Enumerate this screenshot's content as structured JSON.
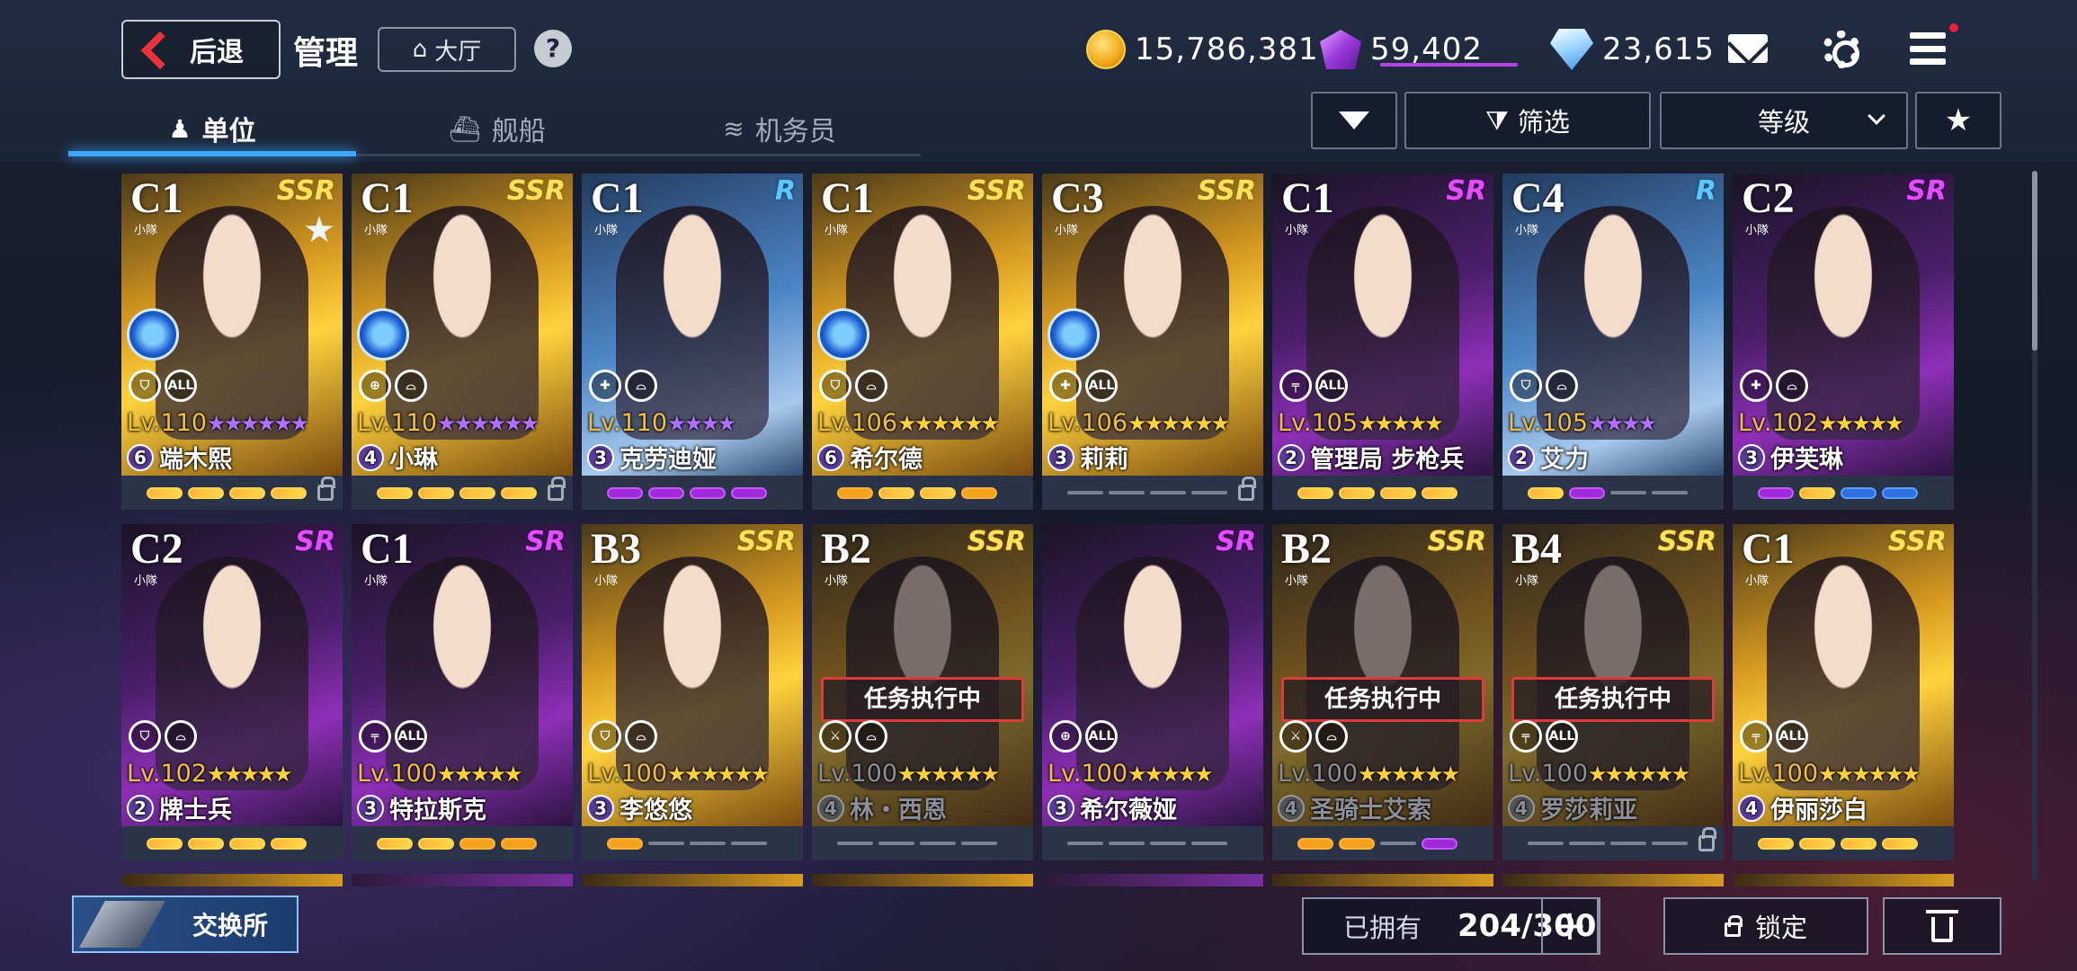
{
  "header": {
    "back_label": "后退",
    "title": "管理",
    "hall_label": "大厅",
    "help_label": "?"
  },
  "currency": {
    "gold": "15,786,381",
    "gems": "59,402",
    "diamonds": "23,615"
  },
  "tabs": [
    {
      "label": "单位",
      "icon": "person-icon",
      "active": true
    },
    {
      "label": "舰船",
      "icon": "ship-icon",
      "active": false
    },
    {
      "label": "机务员",
      "icon": "wings-icon",
      "active": false
    }
  ],
  "filters": {
    "filter_label": "筛选",
    "sort_label": "等级"
  },
  "units": [
    {
      "tier": "C1",
      "squad": "小隊",
      "rarity": "SSR",
      "level": "Lv.110",
      "stars": "★★★★★★",
      "star_color": "p",
      "count": "6",
      "name": "端木熙",
      "progress": [
        "y",
        "y",
        "y",
        "y"
      ],
      "locked": true,
      "favorite": true,
      "badge": true,
      "roles": [
        "shield",
        "ALL"
      ],
      "mission": ""
    },
    {
      "tier": "C1",
      "squad": "小隊",
      "rarity": "SSR",
      "level": "Lv.110",
      "stars": "★★★★★★",
      "star_color": "p",
      "count": "4",
      "name": "小琳",
      "progress": [
        "y",
        "y",
        "y",
        "y"
      ],
      "locked": true,
      "favorite": false,
      "badge": true,
      "roles": [
        "target",
        "sat"
      ],
      "mission": ""
    },
    {
      "tier": "C1",
      "squad": "小隊",
      "rarity": "R",
      "level": "Lv.110",
      "stars": "★★★★",
      "star_color": "p",
      "count": "3",
      "name": "克劳迪娅",
      "progress": [
        "p",
        "p",
        "p",
        "p"
      ],
      "locked": false,
      "favorite": false,
      "badge": false,
      "roles": [
        "support",
        "sat"
      ],
      "mission": ""
    },
    {
      "tier": "C1",
      "squad": "小隊",
      "rarity": "SSR",
      "level": "Lv.106",
      "stars": "★★★★★★",
      "star_color": "y",
      "count": "6",
      "name": "希尔德",
      "progress": [
        "o",
        "y",
        "y",
        "o"
      ],
      "locked": false,
      "favorite": false,
      "badge": true,
      "roles": [
        "shield",
        "sat"
      ],
      "mission": ""
    },
    {
      "tier": "C3",
      "squad": "小隊",
      "rarity": "SSR",
      "level": "Lv.106",
      "stars": "★★★★★★",
      "star_color": "y",
      "count": "3",
      "name": "莉莉",
      "progress": [
        "e",
        "e",
        "e",
        "e"
      ],
      "locked": true,
      "favorite": false,
      "badge": true,
      "roles": [
        "support",
        "ALL"
      ],
      "mission": ""
    },
    {
      "tier": "C1",
      "squad": "小隊",
      "rarity": "SR",
      "level": "Lv.105",
      "stars": "★★★★★",
      "star_color": "y",
      "count": "2",
      "name": "管理局 步枪兵",
      "progress": [
        "y",
        "y",
        "y",
        "y"
      ],
      "locked": false,
      "favorite": false,
      "badge": false,
      "roles": [
        "rifle",
        "ALL"
      ],
      "mission": ""
    },
    {
      "tier": "C4",
      "squad": "小隊",
      "rarity": "R",
      "level": "Lv.105",
      "stars": "★★★★",
      "star_color": "p",
      "count": "2",
      "name": "艾力",
      "progress": [
        "y",
        "p",
        "e",
        "e"
      ],
      "locked": false,
      "favorite": false,
      "badge": false,
      "roles": [
        "shield",
        "sat"
      ],
      "mission": ""
    },
    {
      "tier": "C2",
      "squad": "小隊",
      "rarity": "SR",
      "level": "Lv.102",
      "stars": "★★★★★",
      "star_color": "y",
      "count": "3",
      "name": "伊芙琳",
      "progress": [
        "p",
        "y",
        "b",
        "b"
      ],
      "locked": false,
      "favorite": false,
      "badge": false,
      "roles": [
        "support",
        "sat"
      ],
      "mission": ""
    },
    {
      "tier": "C2",
      "squad": "小隊",
      "rarity": "SR",
      "level": "Lv.102",
      "stars": "★★★★★",
      "star_color": "y",
      "count": "2",
      "name": "牌士兵",
      "progress": [
        "y",
        "y",
        "y",
        "y"
      ],
      "locked": false,
      "favorite": false,
      "badge": false,
      "roles": [
        "shield",
        "sat"
      ],
      "mission": ""
    },
    {
      "tier": "C1",
      "squad": "小隊",
      "rarity": "SR",
      "level": "Lv.100",
      "stars": "★★★★★",
      "star_color": "y",
      "count": "3",
      "name": "特拉斯克",
      "progress": [
        "y",
        "y",
        "o",
        "o"
      ],
      "locked": false,
      "favorite": false,
      "badge": false,
      "roles": [
        "rifle",
        "ALL"
      ],
      "mission": ""
    },
    {
      "tier": "B3",
      "squad": "小隊",
      "rarity": "SSR",
      "level": "Lv.100",
      "stars": "★★★★★★",
      "star_color": "y",
      "count": "3",
      "name": "李悠悠",
      "progress": [
        "o",
        "e",
        "e",
        "e"
      ],
      "locked": false,
      "favorite": false,
      "badge": false,
      "roles": [
        "shield",
        "sat"
      ],
      "mission": ""
    },
    {
      "tier": "B2",
      "squad": "小隊",
      "rarity": "SSR",
      "level": "Lv.100",
      "stars": "★★★★★★",
      "star_color": "y",
      "count": "4",
      "name": "林・西恩",
      "progress": [
        "e",
        "e",
        "e",
        "e"
      ],
      "locked": false,
      "favorite": false,
      "badge": false,
      "roles": [
        "sword",
        "sat"
      ],
      "mission": "任务执行中"
    },
    {
      "tier": "",
      "squad": "",
      "rarity": "SR",
      "level": "Lv.100",
      "stars": "★★★★★",
      "star_color": "y",
      "count": "3",
      "name": "希尔薇娅",
      "progress": [
        "e",
        "e",
        "e",
        "e"
      ],
      "locked": false,
      "favorite": false,
      "badge": false,
      "roles": [
        "target",
        "ALL"
      ],
      "mission": ""
    },
    {
      "tier": "B2",
      "squad": "小隊",
      "rarity": "SSR",
      "level": "Lv.100",
      "stars": "★★★★★★",
      "star_color": "y",
      "count": "4",
      "name": "圣骑士艾索",
      "progress": [
        "o",
        "o",
        "e",
        "p"
      ],
      "locked": false,
      "favorite": false,
      "badge": false,
      "roles": [
        "sword",
        "sat"
      ],
      "mission": "任务执行中"
    },
    {
      "tier": "B4",
      "squad": "小隊",
      "rarity": "SSR",
      "level": "Lv.100",
      "stars": "★★★★★★",
      "star_color": "y",
      "count": "4",
      "name": "罗莎莉亚",
      "progress": [
        "e",
        "e",
        "e",
        "e"
      ],
      "locked": true,
      "favorite": false,
      "badge": false,
      "roles": [
        "rifle",
        "ALL"
      ],
      "mission": "任务执行中"
    },
    {
      "tier": "C1",
      "squad": "小隊",
      "rarity": "SSR",
      "level": "Lv.100",
      "stars": "★★★★★★",
      "star_color": "y",
      "count": "4",
      "name": "伊丽莎白",
      "progress": [
        "y",
        "y",
        "y",
        "y"
      ],
      "locked": false,
      "favorite": false,
      "badge": false,
      "roles": [
        "rifle",
        "ALL"
      ],
      "mission": ""
    }
  ],
  "footer": {
    "exchange_label": "交换所",
    "owned_label": "已拥有",
    "owned_value": "204/300",
    "plus_label": "+",
    "lock_label": "锁定"
  },
  "colors": {
    "accent": "#3ea6ff",
    "mission_border": "#e03a3a",
    "gem_underline": "#b445e5"
  }
}
